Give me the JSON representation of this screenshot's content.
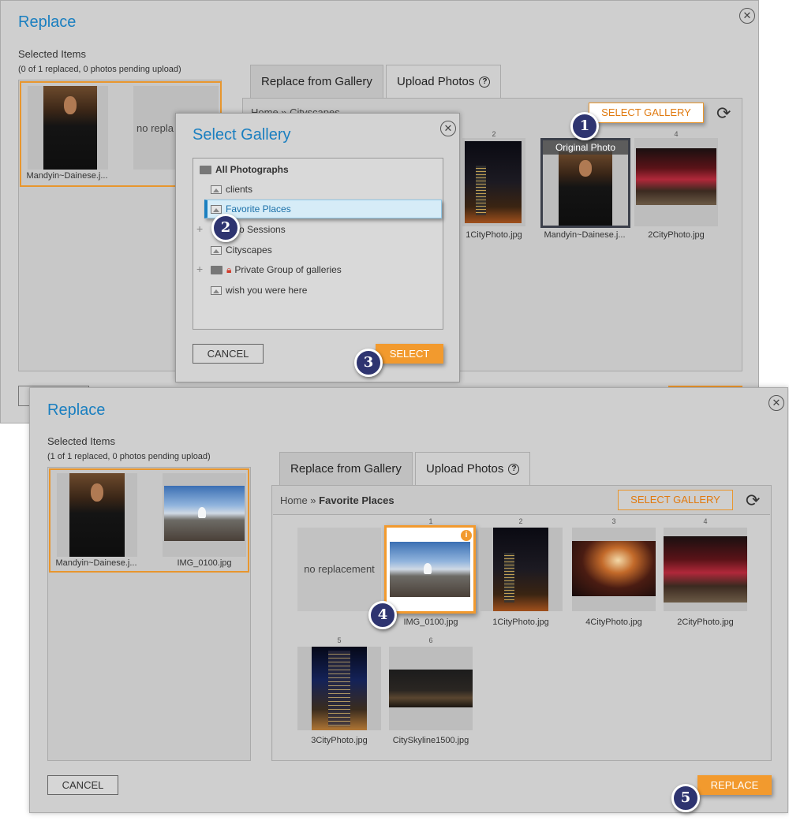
{
  "back_dialog": {
    "title": "Replace",
    "selected_label": "Selected Items",
    "status": "(0 of 1 replaced, 0 photos pending upload)",
    "selected_items": [
      {
        "filename": "Mandyin~Dainese.j...",
        "replacement": "no repla"
      }
    ],
    "tabs": [
      {
        "label": "Replace from Gallery"
      },
      {
        "label": "Upload Photos"
      }
    ],
    "breadcrumb": "Home » Cityscapes",
    "select_gallery": "SELECT GALLERY",
    "original_overlay": "Original Photo",
    "grid": [
      {
        "num": "2",
        "filename": "1CityPhoto.jpg"
      },
      {
        "num": "",
        "filename": "Mandyin~Dainese.j..."
      },
      {
        "num": "4",
        "filename": "2CityPhoto.jpg"
      }
    ]
  },
  "select_gallery_modal": {
    "title": "Select Gallery",
    "tree": [
      {
        "label": "All Photographs",
        "type": "folder"
      },
      {
        "label": "clients",
        "type": "gallery"
      },
      {
        "label": "Favorite Places",
        "type": "gallery",
        "selected": true
      },
      {
        "label": "o Sessions",
        "type": "folder"
      },
      {
        "label": "Cityscapes",
        "type": "gallery"
      },
      {
        "label": "Private Group of galleries",
        "type": "folder"
      },
      {
        "label": "wish you were here",
        "type": "gallery"
      }
    ],
    "cancel": "CANCEL",
    "select": "SELECT"
  },
  "front_dialog": {
    "title": "Replace",
    "selected_label": "Selected Items",
    "status": "(1 of 1 replaced, 0 photos pending upload)",
    "selected_items": [
      {
        "filename": "Mandyin~Dainese.j..."
      },
      {
        "filename": "IMG_0100.jpg"
      }
    ],
    "tabs": [
      {
        "label": "Replace from Gallery"
      },
      {
        "label": "Upload Photos"
      }
    ],
    "breadcrumb_home": "Home »",
    "breadcrumb_current": "Favorite Places",
    "select_gallery": "SELECT GALLERY",
    "no_replacement": "no replacement",
    "grid": [
      {
        "num": "1",
        "filename": "IMG_0100.jpg"
      },
      {
        "num": "2",
        "filename": "1CityPhoto.jpg"
      },
      {
        "num": "3",
        "filename": "4CityPhoto.jpg"
      },
      {
        "num": "4",
        "filename": "2CityPhoto.jpg"
      },
      {
        "num": "5",
        "filename": "3CityPhoto.jpg"
      },
      {
        "num": "6",
        "filename": "CitySkyline1500.jpg"
      }
    ],
    "cancel": "CANCEL",
    "replace": "REPLACE"
  },
  "steps": [
    "1",
    "2",
    "3",
    "4",
    "5"
  ],
  "colors": {
    "accent_blue": "#1a7fc0",
    "orange": "#f29a2e",
    "step_navy": "#2e3470"
  }
}
